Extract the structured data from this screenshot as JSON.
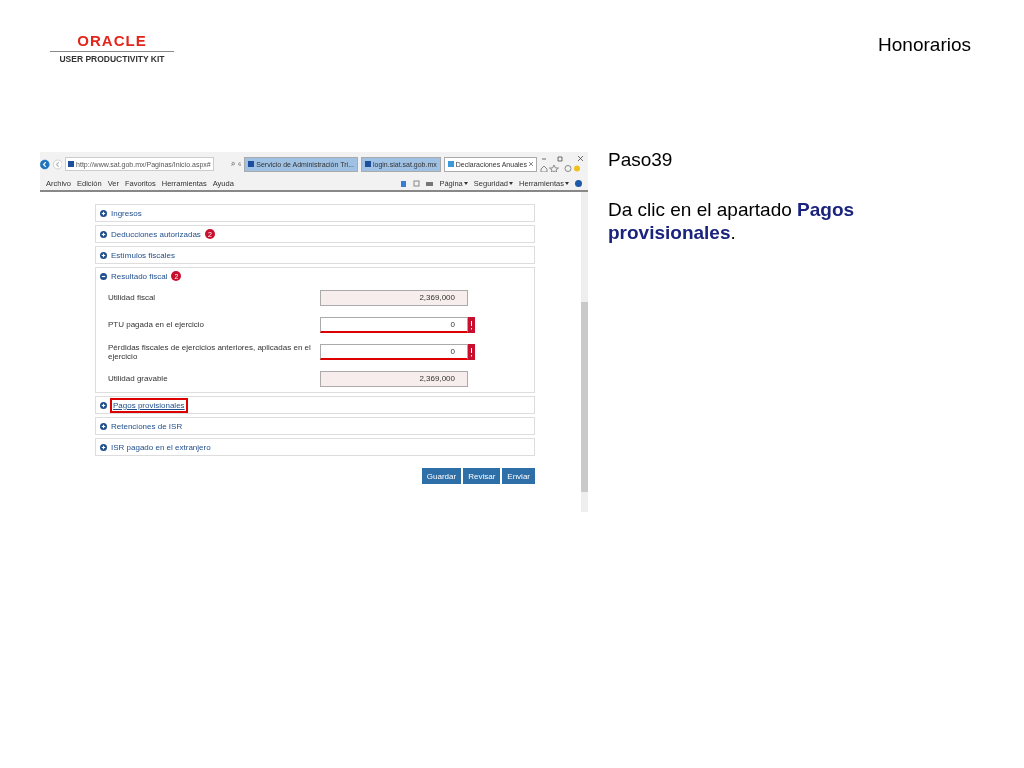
{
  "header": {
    "logo": {
      "brand": "ORACLE",
      "product": "USER PRODUCTIVITY KIT"
    },
    "title": "Honorarios"
  },
  "screenshot": {
    "browser": {
      "address": "http://www.sat.gob.mx/Paginas/Inicio.aspx#",
      "tabs": [
        {
          "label": "Servicio de Administración Tri...",
          "selected": false
        },
        {
          "label": "login.siat.sat.gob.mx",
          "selected": false
        },
        {
          "label": "Declaraciones Anuales",
          "selected": true
        }
      ],
      "menu": [
        "Archivo",
        "Edición",
        "Ver",
        "Favoritos",
        "Herramientas",
        "Ayuda"
      ],
      "commands": [
        "Página",
        "Seguridad",
        "Herramientas"
      ]
    },
    "sections": [
      {
        "label": "Ingresos",
        "expanded": false,
        "highlighted": false
      },
      {
        "label": "Deducciones autorizadas",
        "badge": "2",
        "expanded": false,
        "highlighted": false
      },
      {
        "label": "Estímulos fiscales",
        "expanded": false,
        "highlighted": false
      },
      {
        "label": "Resultado fiscal",
        "badge": "2",
        "expanded": true,
        "highlighted": false,
        "fields": [
          {
            "label": "Utilidad fiscal",
            "value": "2,369,000",
            "kind": "readonly"
          },
          {
            "label": "PTU pagada en el ejercicio",
            "value": "0",
            "kind": "error"
          },
          {
            "label": "Pérdidas fiscales de ejercicios anteriores, aplicadas en el ejercicio",
            "value": "0",
            "kind": "error"
          },
          {
            "label": "Utilidad gravable",
            "value": "2,369,000",
            "kind": "readonly"
          }
        ]
      },
      {
        "label": "Pagos provisionales",
        "expanded": false,
        "highlighted": true
      },
      {
        "label": "Retenciones de ISR",
        "expanded": false,
        "highlighted": false
      },
      {
        "label": "ISR pagado en el extranjero",
        "expanded": false,
        "highlighted": false
      }
    ],
    "buttons": [
      "Guardar",
      "Revisar",
      "Enviar"
    ]
  },
  "step": {
    "title": "Paso39",
    "instruction": "Da clic en el apartado **Pagos provisionales**."
  }
}
